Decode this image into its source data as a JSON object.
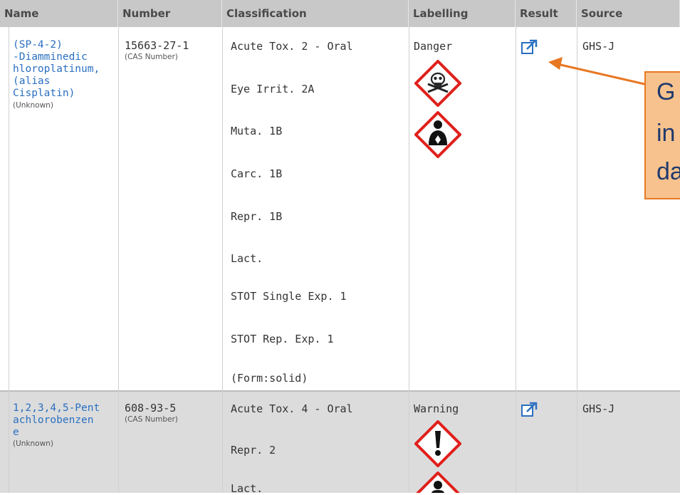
{
  "columns": [
    "Name",
    "Number",
    "Classification",
    "Labelling",
    "Result",
    "Source"
  ],
  "rows": [
    {
      "name_lines": [
        "(SP-4-2)",
        "-Diamminedic",
        "hloroplatinum,",
        "(alias",
        "Cisplatin)"
      ],
      "name_note": "(Unknown)",
      "number": "15663-27-1",
      "number_note": "(CAS Number)",
      "classifications": [
        "Acute Tox. 2 - Oral",
        "Eye Irrit. 2A",
        "Muta. 1B",
        "Carc. 1B",
        "Repr. 1B",
        "Lact.",
        "STOT Single Exp. 1",
        "STOT Rep. Exp. 1",
        "(Form:solid)"
      ],
      "signal_word": "Danger",
      "pictograms": [
        "skull-crossbones-icon",
        "health-hazard-icon"
      ],
      "source": "GHS-J"
    },
    {
      "name_lines": [
        "1,2,3,4,5-Pent",
        "achlorobenzen",
        "e"
      ],
      "name_note": "(Unknown)",
      "number": "608-93-5",
      "number_note": "(CAS Number)",
      "classifications": [
        "Acute Tox. 4 - Oral",
        "Repr. 2",
        "Lact."
      ],
      "signal_word": "Warning",
      "pictograms": [
        "exclamation-mark-icon",
        "health-hazard-icon"
      ],
      "source": "GHS-J"
    }
  ],
  "callout": {
    "lines": [
      "G",
      "in",
      "da"
    ],
    "fill": "#f7c28d",
    "border": "#e87722",
    "arrow_color": "#e87722"
  },
  "colors": {
    "link": "#2a6fc0",
    "header_bg": "#c8c8c8",
    "row_alt_bg": "#dcdcdc",
    "pictogram_border": "#e0201b"
  }
}
